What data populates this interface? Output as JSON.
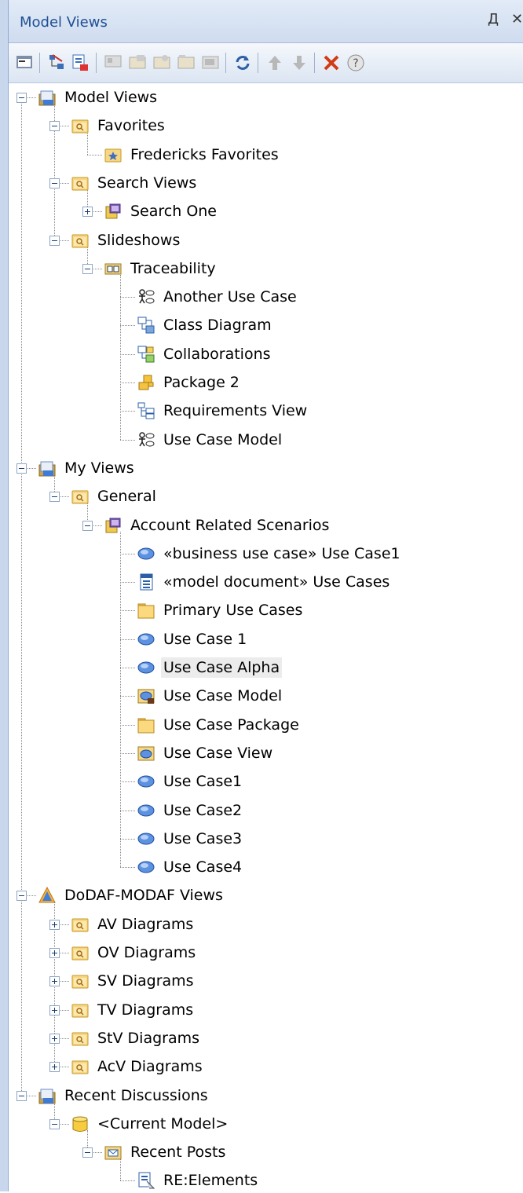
{
  "panel": {
    "title": "Model Views",
    "pin_glyph": "Д",
    "close_glyph": "✕"
  },
  "toolbar": {
    "buttons": [
      {
        "icon": "properties-icon"
      },
      {
        "icon": "new-view-icon"
      },
      {
        "icon": "new-search-view-icon"
      },
      {
        "icon": "new-slideshow-icon"
      },
      {
        "icon": "add-diagram-icon"
      },
      {
        "icon": "add-element-icon"
      },
      {
        "icon": "add-package-icon"
      },
      {
        "icon": "add-folder-icon"
      },
      {
        "icon": "refresh-icon"
      },
      {
        "icon": "move-up-icon"
      },
      {
        "icon": "move-down-icon"
      },
      {
        "icon": "delete-icon"
      },
      {
        "icon": "help-icon"
      }
    ]
  },
  "tree": [
    {
      "label": "Model Views",
      "icon": "model-views-root-icon",
      "level": 0,
      "toggle": "minus"
    },
    {
      "label": "Favorites",
      "icon": "search-folder-icon",
      "level": 1,
      "toggle": "minus"
    },
    {
      "label": "Fredericks Favorites",
      "icon": "favorites-folder-icon",
      "level": 2,
      "toggle": null
    },
    {
      "label": "Search Views",
      "icon": "search-folder-icon",
      "level": 1,
      "toggle": "minus"
    },
    {
      "label": "Search One",
      "icon": "search-view-icon",
      "level": 2,
      "toggle": "plus"
    },
    {
      "label": "Slideshows",
      "icon": "search-folder-icon",
      "level": 1,
      "toggle": "minus"
    },
    {
      "label": "Traceability",
      "icon": "slideshow-icon",
      "level": 2,
      "toggle": "minus"
    },
    {
      "label": "Another Use Case",
      "icon": "use-case-diagram-icon",
      "level": 3,
      "toggle": null
    },
    {
      "label": "Class Diagram",
      "icon": "class-diagram-icon",
      "level": 3,
      "toggle": null
    },
    {
      "label": "Collaborations",
      "icon": "collaboration-diagram-icon",
      "level": 3,
      "toggle": null
    },
    {
      "label": "Package 2",
      "icon": "package-diagram-icon",
      "level": 3,
      "toggle": null
    },
    {
      "label": "Requirements View",
      "icon": "requirements-diagram-icon",
      "level": 3,
      "toggle": null
    },
    {
      "label": "Use Case Model",
      "icon": "use-case-diagram-icon",
      "level": 3,
      "toggle": null
    },
    {
      "label": "My Views",
      "icon": "model-views-root-icon",
      "level": 0,
      "toggle": "minus"
    },
    {
      "label": "General",
      "icon": "search-folder-icon",
      "level": 1,
      "toggle": "minus"
    },
    {
      "label": "Account Related Scenarios",
      "icon": "search-view-icon",
      "level": 2,
      "toggle": "minus"
    },
    {
      "label": "«business use case» Use Case1",
      "icon": "use-case-icon",
      "level": 3,
      "toggle": null
    },
    {
      "label": "«model document» Use Cases",
      "icon": "model-document-icon",
      "level": 3,
      "toggle": null
    },
    {
      "label": "Primary Use Cases",
      "icon": "package-folder-icon",
      "level": 3,
      "toggle": null
    },
    {
      "label": "Use Case 1",
      "icon": "use-case-icon",
      "level": 3,
      "toggle": null
    },
    {
      "label": "Use Case Alpha",
      "icon": "use-case-icon",
      "level": 3,
      "toggle": null,
      "selected": true
    },
    {
      "label": "Use Case Model",
      "icon": "use-case-model-icon",
      "level": 3,
      "toggle": null
    },
    {
      "label": "Use Case Package",
      "icon": "package-folder-icon",
      "level": 3,
      "toggle": null
    },
    {
      "label": "Use Case View",
      "icon": "use-case-view-icon",
      "level": 3,
      "toggle": null
    },
    {
      "label": "Use Case1",
      "icon": "use-case-icon",
      "level": 3,
      "toggle": null
    },
    {
      "label": "Use Case2",
      "icon": "use-case-icon",
      "level": 3,
      "toggle": null
    },
    {
      "label": "Use Case3",
      "icon": "use-case-icon",
      "level": 3,
      "toggle": null
    },
    {
      "label": "Use Case4",
      "icon": "use-case-icon",
      "level": 3,
      "toggle": null
    },
    {
      "label": "DoDAF-MODAF Views",
      "icon": "dodaf-triangle-icon",
      "level": 0,
      "toggle": "minus"
    },
    {
      "label": "AV Diagrams",
      "icon": "search-folder-icon",
      "level": 1,
      "toggle": "plus"
    },
    {
      "label": "OV Diagrams",
      "icon": "search-folder-icon",
      "level": 1,
      "toggle": "plus"
    },
    {
      "label": "SV Diagrams",
      "icon": "search-folder-icon",
      "level": 1,
      "toggle": "plus"
    },
    {
      "label": "TV Diagrams",
      "icon": "search-folder-icon",
      "level": 1,
      "toggle": "plus"
    },
    {
      "label": "StV Diagrams",
      "icon": "search-folder-icon",
      "level": 1,
      "toggle": "plus"
    },
    {
      "label": "AcV Diagrams",
      "icon": "search-folder-icon",
      "level": 1,
      "toggle": "plus"
    },
    {
      "label": "Recent Discussions",
      "icon": "model-views-root-icon",
      "level": 0,
      "toggle": "minus"
    },
    {
      "label": "<Current Model>",
      "icon": "database-icon",
      "level": 1,
      "toggle": "minus"
    },
    {
      "label": "Recent Posts",
      "icon": "mail-folder-icon",
      "level": 2,
      "toggle": "minus"
    },
    {
      "label": "RE:Elements",
      "icon": "post-icon",
      "level": 3,
      "toggle": null
    }
  ]
}
